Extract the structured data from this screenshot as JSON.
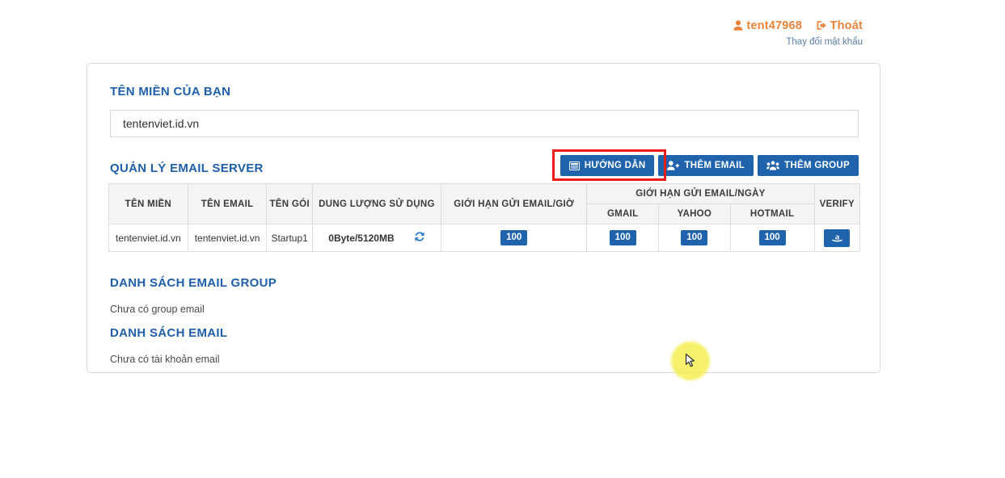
{
  "account": {
    "user_icon": "user-icon",
    "username": "tent47968",
    "logout_icon": "sign-out-icon",
    "logout_label": "Thoát",
    "change_password_label": "Thay đổi mật khẩu"
  },
  "domain_section": {
    "title": "TÊN MIỀN CỦA BẠN",
    "value": "tentenviet.id.vn"
  },
  "management": {
    "title": "QUẢN LÝ EMAIL SERVER",
    "buttons": [
      {
        "label": "HƯỚNG DẪN",
        "icon": "book-icon",
        "highlighted": true
      },
      {
        "label": "THÊM EMAIL",
        "icon": "user-plus-icon",
        "highlighted": false
      },
      {
        "label": "THÊM GROUP",
        "icon": "users-group-icon",
        "highlighted": false
      }
    ]
  },
  "table": {
    "headers": {
      "domain": "TÊN MIỀN",
      "email": "TÊN EMAIL",
      "package": "TÊN GÓI",
      "usage": "DUNG LƯỢNG SỬ DỤNG",
      "limit_hour": "GIỚI HẠN GỬI EMAIL/GIỜ",
      "limit_day": "GIỚI HẠN GỬI EMAIL/NGÀY",
      "gmail": "GMAIL",
      "yahoo": "YAHOO",
      "hotmail": "HOTMAIL",
      "verify": "VERIFY"
    },
    "rows": [
      {
        "domain": "tentenviet.id.vn",
        "email": "tentenviet.id.vn",
        "package": "Startup1",
        "usage": "0Byte/5120MB",
        "refresh_icon": "refresh-icon",
        "limit_hour": "100",
        "gmail": "100",
        "yahoo": "100",
        "hotmail": "100",
        "verify_icon": "amazon-a-icon"
      }
    ]
  },
  "group_list": {
    "title": "DANH SÁCH EMAIL GROUP",
    "empty_text": "Chưa có group email"
  },
  "email_list": {
    "title": "DANH SÁCH EMAIL",
    "empty_text": "Chưa có tài khoản email"
  },
  "colors": {
    "accent_blue": "#1f63ad",
    "heading_blue": "#1f5fa9",
    "account_orange": "#e8833a",
    "highlight_red": "#ee1b1b",
    "cursor_glow": "#f5ee4a"
  }
}
